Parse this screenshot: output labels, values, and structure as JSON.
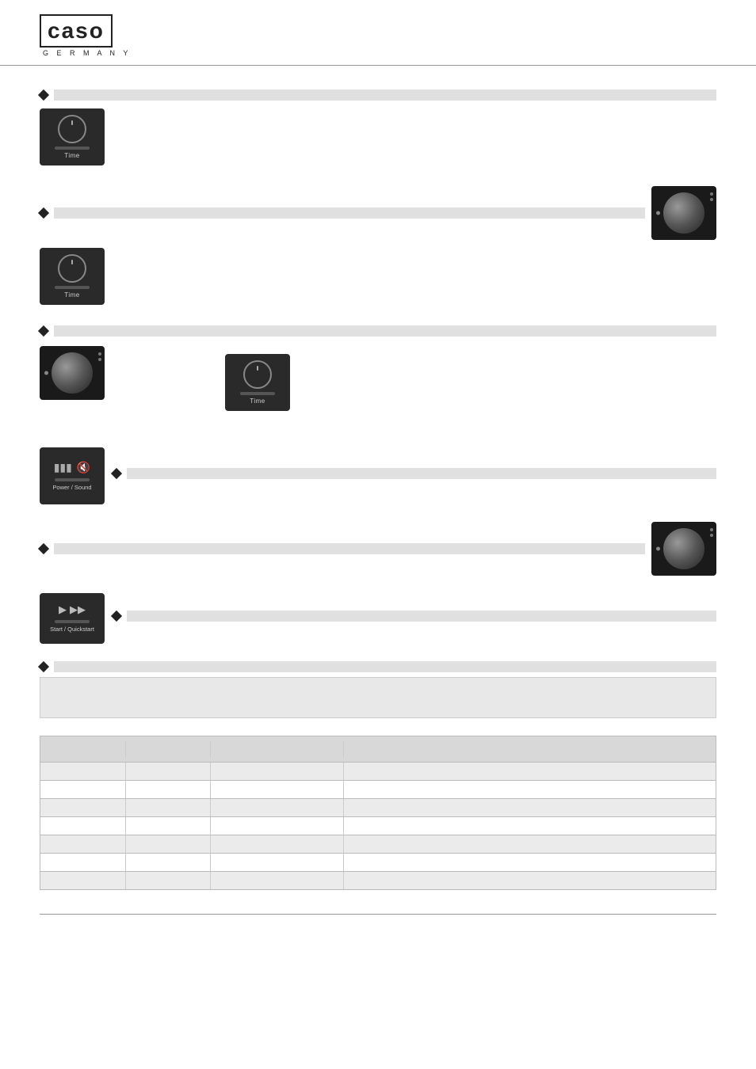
{
  "header": {
    "logo_text": "caso",
    "logo_sub": "G E R M A N Y"
  },
  "sections": [
    {
      "id": "sec1",
      "bullet": "◆",
      "widget": "time",
      "widget_label": "Time",
      "has_right_widget": false
    },
    {
      "id": "sec2",
      "bullet": "◆",
      "widget": "time",
      "widget_label": "Time",
      "has_right_widget": true
    },
    {
      "id": "sec3",
      "bullet": "◆",
      "widget": "round-knob",
      "center_widget": "time",
      "center_label": "Time",
      "has_right_widget": false
    },
    {
      "id": "sec4",
      "bullet": "◆",
      "widget": "power-sound",
      "widget_label": "Power / Sound",
      "has_right_widget": false
    },
    {
      "id": "sec5",
      "bullet": "◆",
      "widget": null,
      "has_right_widget": true
    },
    {
      "id": "sec6",
      "bullet": "◆",
      "widget": "start-quickstart",
      "widget_label": "Start / Quickstart",
      "has_right_widget": false
    },
    {
      "id": "sec7",
      "bullet": "◆",
      "widget": null,
      "has_right_widget": false,
      "is_desc": true
    }
  ],
  "table": {
    "header": [
      "",
      "",
      "",
      ""
    ],
    "rows": [
      [
        "",
        "",
        "",
        ""
      ],
      [
        "",
        "",
        "",
        ""
      ],
      [
        "",
        "",
        "",
        ""
      ],
      [
        "",
        "",
        "",
        ""
      ],
      [
        "",
        "",
        "",
        ""
      ],
      [
        "",
        "",
        "",
        ""
      ],
      [
        "",
        "",
        "",
        ""
      ]
    ]
  }
}
